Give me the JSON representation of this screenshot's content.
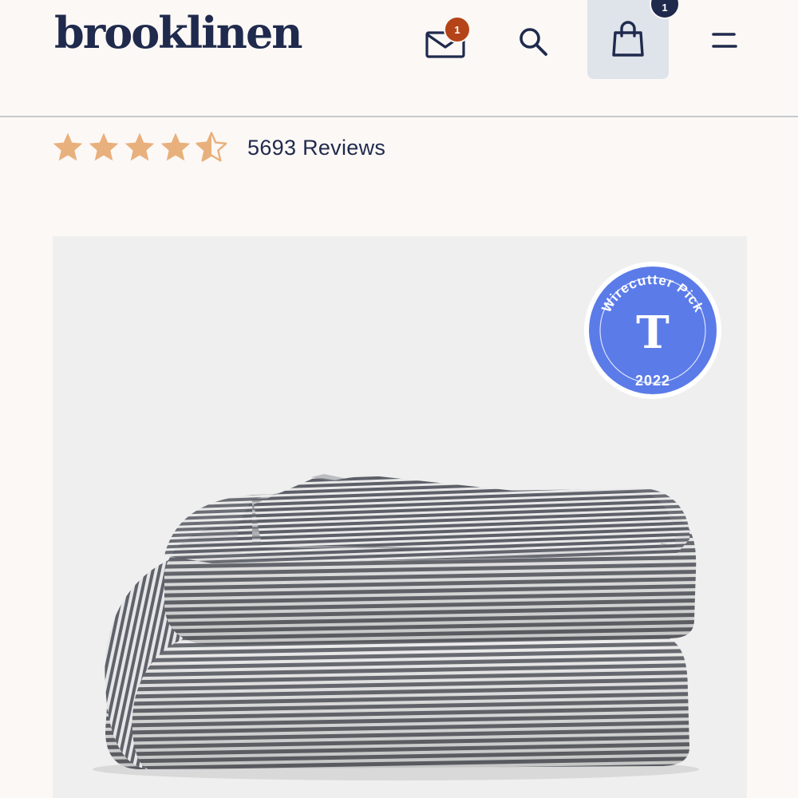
{
  "header": {
    "logo_text": "brooklinen",
    "mail_badge_count": "1",
    "cart_badge_count": "1"
  },
  "icons": {
    "mail": "envelope-icon",
    "search": "search-icon",
    "cart": "shopping-bag-icon",
    "menu": "menu-icon",
    "star": "star-icon"
  },
  "rating": {
    "value": 4.5,
    "max": 5,
    "reviews_label": "5693 Reviews"
  },
  "product": {
    "image_subject": "folded striped duvet cover",
    "award": {
      "name": "Wirecutter Pick",
      "year": "2022"
    }
  },
  "colors": {
    "background": "#fcf8f5",
    "brand_navy": "#1f2a4d",
    "star_fill": "#e8b07c",
    "notification_badge": "#b44417",
    "award_blue": "#5b7be8",
    "media_background": "#efefef",
    "cart_button_bg": "#dfe3ea"
  }
}
